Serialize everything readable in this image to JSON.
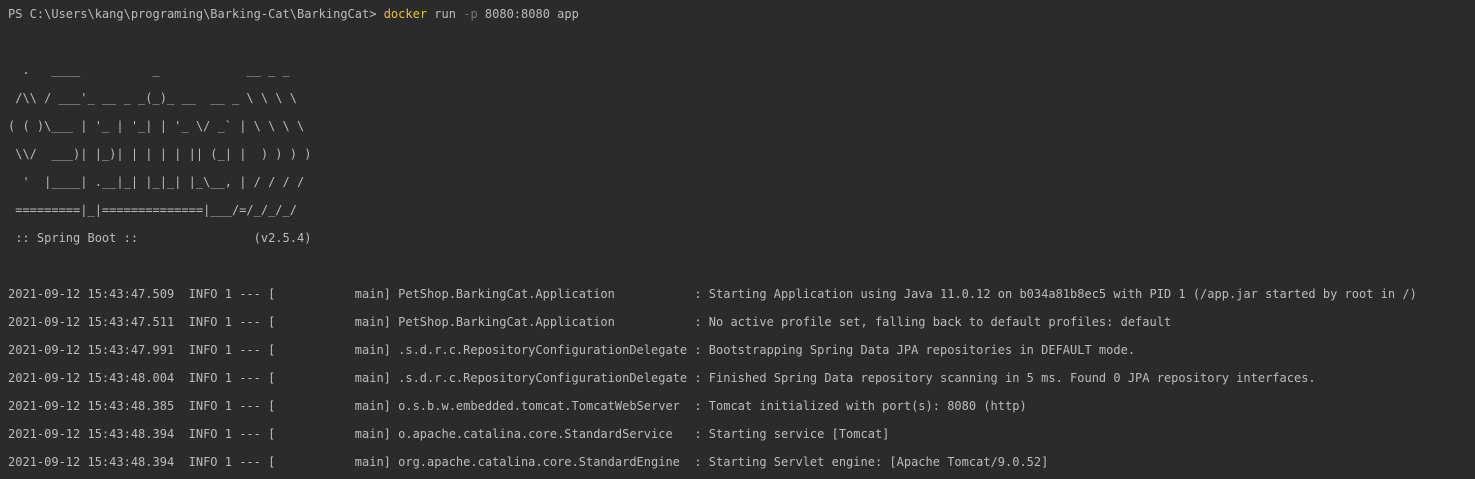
{
  "prompt": {
    "path": "PS C:\\Users\\kang\\programing\\Barking-Cat\\BarkingCat>",
    "command": "docker",
    "arg1": "run",
    "flag": "-p",
    "ports": "8080:8080",
    "image": "app"
  },
  "banner": [
    "  .   ____          _            __ _ _",
    " /\\\\ / ___'_ __ _ _(_)_ __  __ _ \\ \\ \\ \\",
    "( ( )\\___ | '_ | '_| | '_ \\/ _` | \\ \\ \\ \\",
    " \\\\/  ___)| |_)| | | | | || (_| |  ) ) ) )",
    "  '  |____| .__|_| |_|_| |_\\__, | / / / /",
    " =========|_|==============|___/=/_/_/_/",
    " :: Spring Boot ::                (v2.5.4)"
  ],
  "logs": [
    "2021-09-12 15:43:47.509  INFO 1 --- [           main] PetShop.BarkingCat.Application           : Starting Application using Java 11.0.12 on b034a81b8ec5 with PID 1 (/app.jar started by root in /)",
    "2021-09-12 15:43:47.511  INFO 1 --- [           main] PetShop.BarkingCat.Application           : No active profile set, falling back to default profiles: default",
    "2021-09-12 15:43:47.991  INFO 1 --- [           main] .s.d.r.c.RepositoryConfigurationDelegate : Bootstrapping Spring Data JPA repositories in DEFAULT mode.",
    "2021-09-12 15:43:48.004  INFO 1 --- [           main] .s.d.r.c.RepositoryConfigurationDelegate : Finished Spring Data repository scanning in 5 ms. Found 0 JPA repository interfaces.",
    "2021-09-12 15:43:48.385  INFO 1 --- [           main] o.s.b.w.embedded.tomcat.TomcatWebServer  : Tomcat initialized with port(s): 8080 (http)",
    "2021-09-12 15:43:48.394  INFO 1 --- [           main] o.apache.catalina.core.StandardService   : Starting service [Tomcat]",
    "2021-09-12 15:43:48.394  INFO 1 --- [           main] org.apache.catalina.core.StandardEngine  : Starting Servlet engine: [Apache Tomcat/9.0.52]"
  ]
}
